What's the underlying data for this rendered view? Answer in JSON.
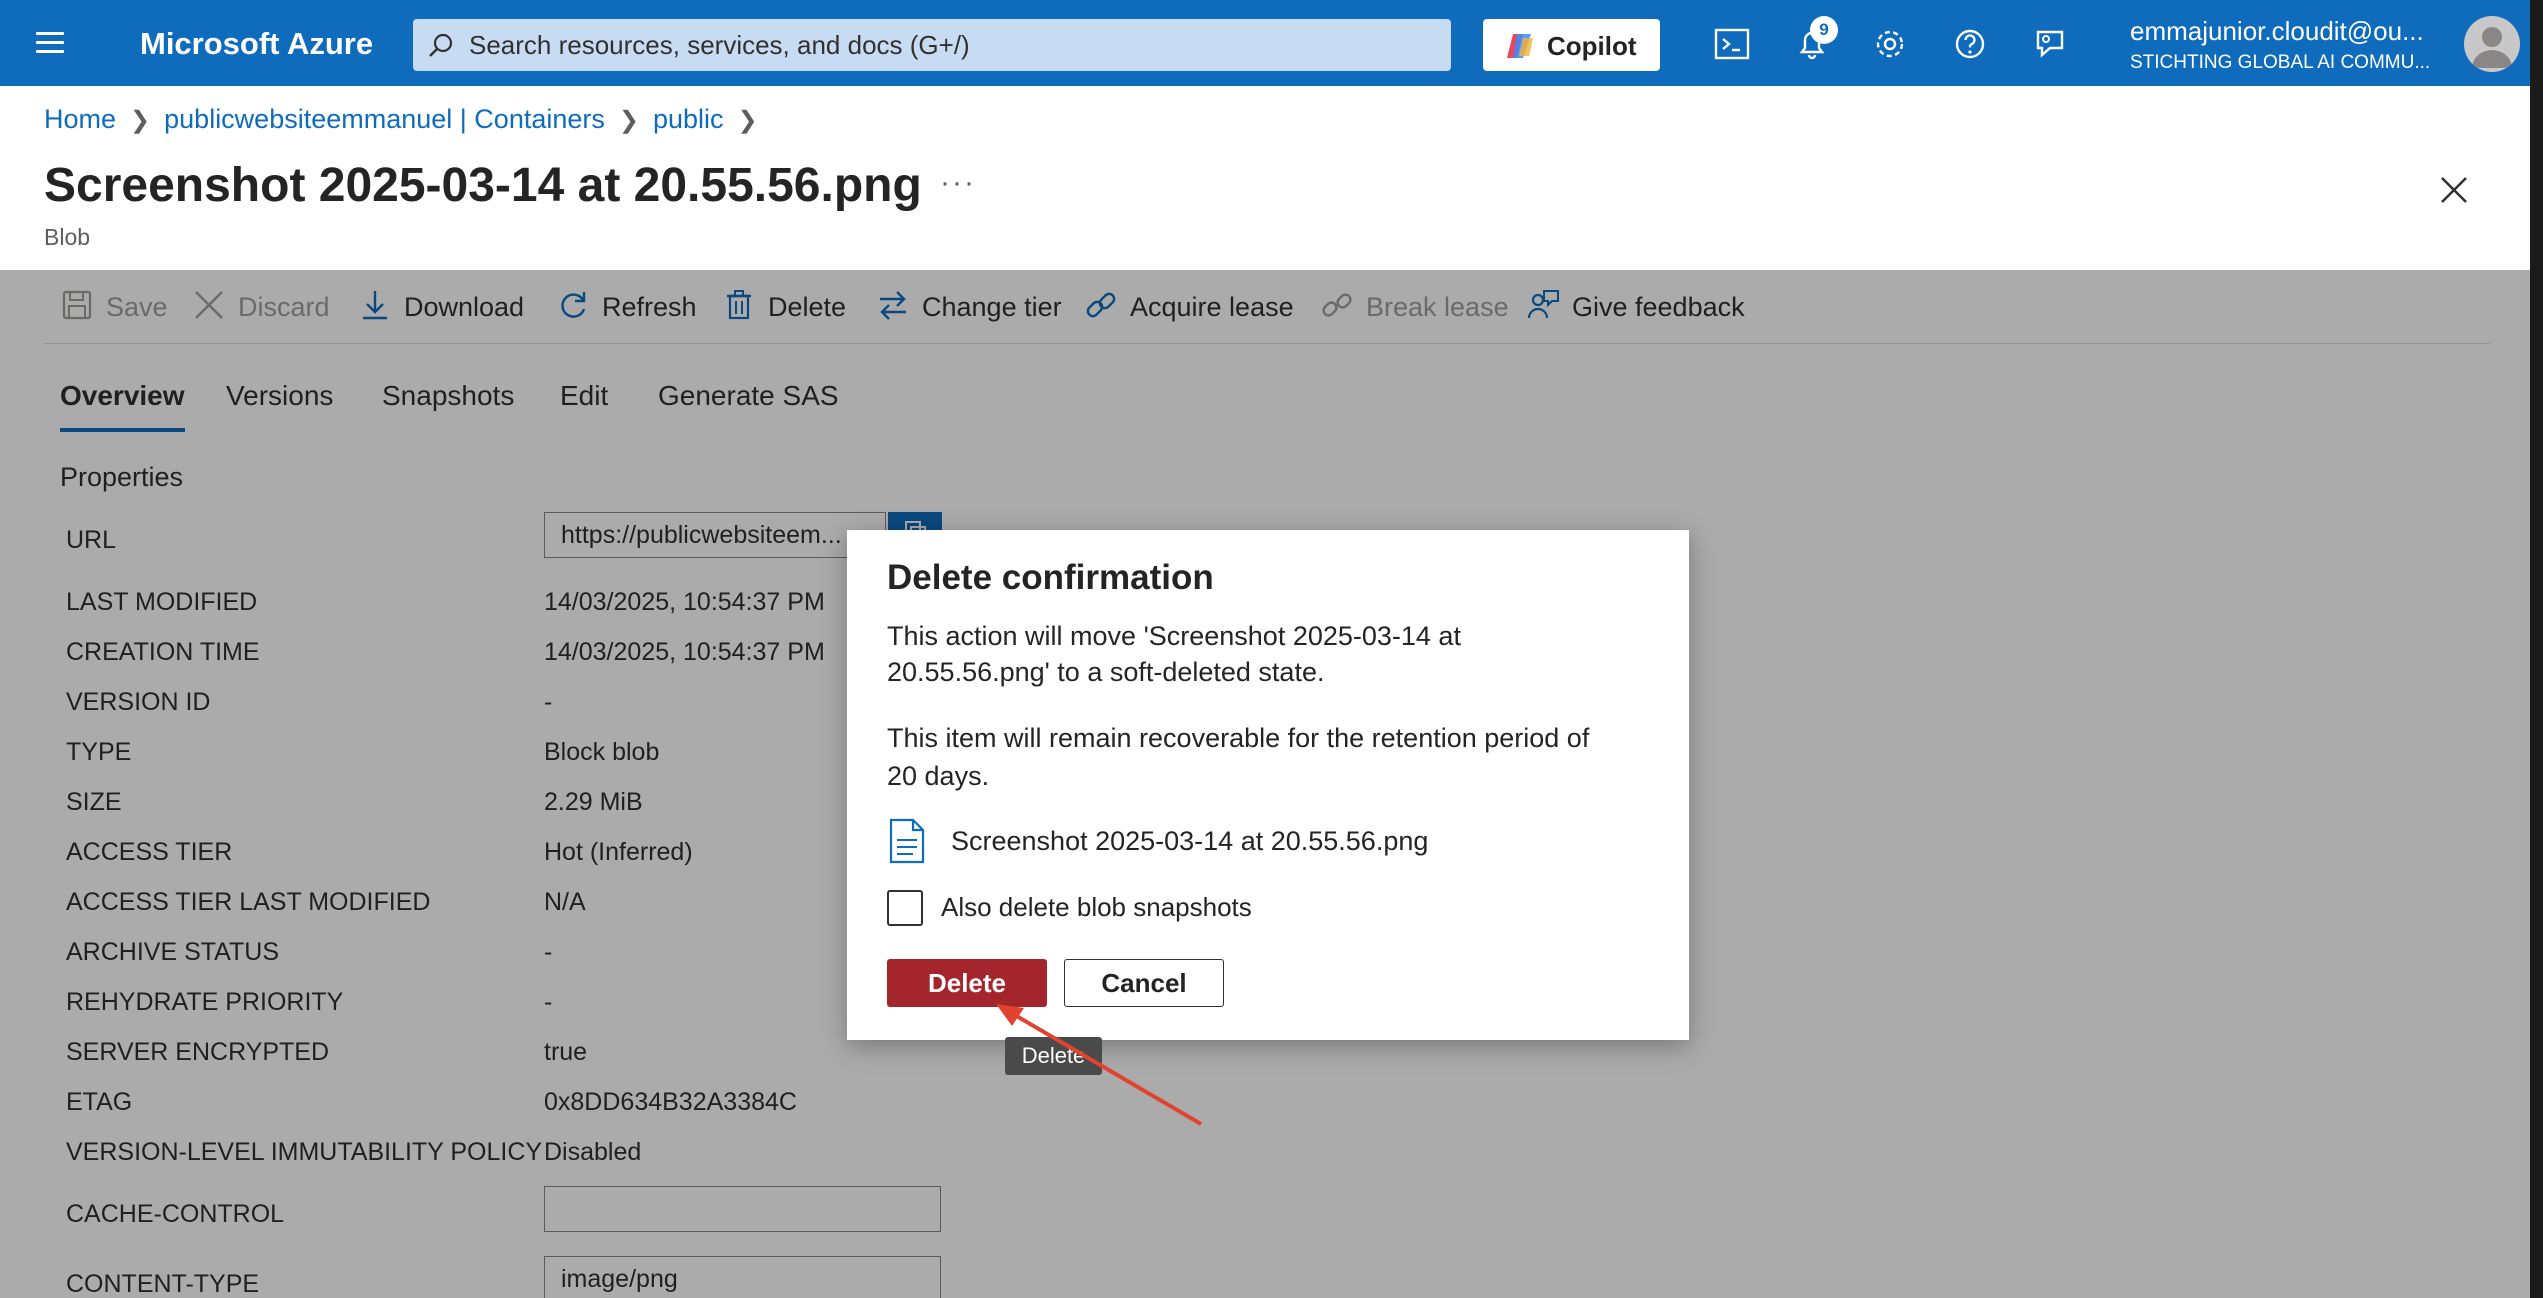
{
  "topbar": {
    "brand": "Microsoft Azure",
    "search_placeholder": "Search resources, services, and docs (G+/)",
    "copilot_label": "Copilot",
    "notification_count": "9",
    "account_email": "emmajunior.cloudit@ou...",
    "account_org": "STICHTING GLOBAL AI COMMU...",
    "accent_color": "#0f6cbd"
  },
  "breadcrumb": [
    "Home",
    "publicwebsiteemmanuel | Containers",
    "public"
  ],
  "page": {
    "title": "Screenshot 2025-03-14 at 20.55.56.png",
    "ellipsis": "···",
    "subtitle": "Blob"
  },
  "toolbar": {
    "save": "Save",
    "discard": "Discard",
    "download": "Download",
    "refresh": "Refresh",
    "delete": "Delete",
    "change_tier": "Change tier",
    "acquire_lease": "Acquire lease",
    "break_lease": "Break lease",
    "give_feedback": "Give feedback"
  },
  "tabs": [
    "Overview",
    "Versions",
    "Snapshots",
    "Edit",
    "Generate SAS"
  ],
  "properties": {
    "title": "Properties",
    "url_label": "URL",
    "url_value": "https://publicwebsiteem...",
    "rows": [
      {
        "label": "LAST MODIFIED",
        "value": "14/03/2025, 10:54:37 PM"
      },
      {
        "label": "CREATION TIME",
        "value": "14/03/2025, 10:54:37 PM"
      },
      {
        "label": "VERSION ID",
        "value": "-"
      },
      {
        "label": "TYPE",
        "value": "Block blob"
      },
      {
        "label": "SIZE",
        "value": "2.29 MiB"
      },
      {
        "label": "ACCESS TIER",
        "value": "Hot (Inferred)"
      },
      {
        "label": "ACCESS TIER LAST MODIFIED",
        "value": "N/A"
      },
      {
        "label": "ARCHIVE STATUS",
        "value": "-"
      },
      {
        "label": "REHYDRATE PRIORITY",
        "value": "-"
      },
      {
        "label": "SERVER ENCRYPTED",
        "value": "true"
      },
      {
        "label": "ETAG",
        "value": "0x8DD634B32A3384C"
      },
      {
        "label": "VERSION-LEVEL IMMUTABILITY POLICY",
        "value": "Disabled"
      }
    ],
    "cache_control_label": "CACHE-CONTROL",
    "cache_control_value": "",
    "content_type_label": "CONTENT-TYPE",
    "content_type_value": "image/png"
  },
  "dialog": {
    "title": "Delete confirmation",
    "message_line1": "This action will move 'Screenshot 2025-03-14 at",
    "message_line2": "20.55.56.png' to a soft-deleted state.",
    "retention_line1": "This item will remain recoverable for the retention period of",
    "retention_line2": "20 days.",
    "file_name": "Screenshot 2025-03-14 at 20.55.56.png",
    "checkbox_label": "Also delete blob snapshots",
    "checkbox_checked": false,
    "delete_button": "Delete",
    "cancel_button": "Cancel",
    "tooltip": "Delete",
    "danger_color": "#a4262c",
    "annotation_arrow_color": "#e0432f"
  }
}
